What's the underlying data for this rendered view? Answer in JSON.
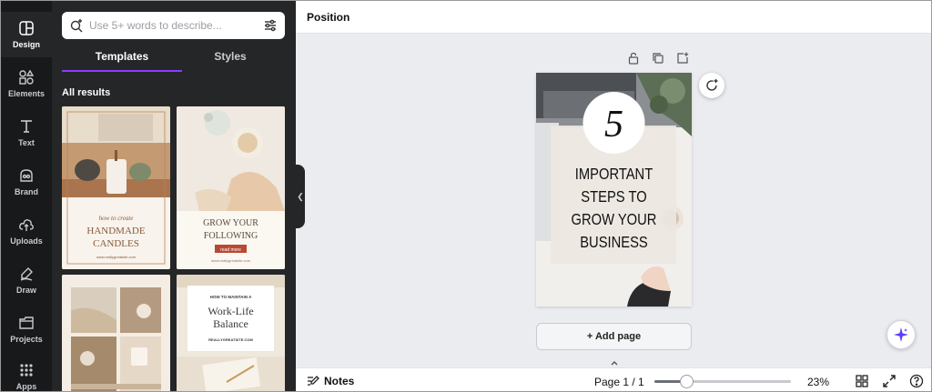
{
  "rail": {
    "items": [
      {
        "label": "Design",
        "icon": "design-icon"
      },
      {
        "label": "Elements",
        "icon": "elements-icon"
      },
      {
        "label": "Text",
        "icon": "text-icon"
      },
      {
        "label": "Brand",
        "icon": "brand-icon"
      },
      {
        "label": "Uploads",
        "icon": "uploads-icon"
      },
      {
        "label": "Draw",
        "icon": "draw-icon"
      },
      {
        "label": "Projects",
        "icon": "projects-icon"
      },
      {
        "label": "Apps",
        "icon": "apps-icon"
      }
    ],
    "active_index": 0
  },
  "panel": {
    "search_placeholder": "Use 5+ words to describe...",
    "tabs": [
      {
        "label": "Templates"
      },
      {
        "label": "Styles"
      }
    ],
    "results_heading": "All results",
    "templates": [
      {
        "line1": "how to create",
        "line2": "HANDMADE",
        "line3": "CANDLES",
        "footer": "www.reallygreatsite.com"
      },
      {
        "line1": "GROW YOUR",
        "line2": "FOLLOWING",
        "button": "read more",
        "footer": "www.reallygreatsite.com"
      },
      {
        "line1": "",
        "line2": ""
      },
      {
        "line1": "HOW TO MAINTAIN A",
        "line2": "Work-Life",
        "line3": "Balance",
        "footer": "REALLYGREATSITE.COM"
      }
    ]
  },
  "topbar": {
    "position_label": "Position"
  },
  "canvas": {
    "design": {
      "number": "5",
      "lines": [
        "IMPORTANT",
        "STEPS TO",
        "GROW YOUR",
        "BUSINESS"
      ]
    },
    "add_page_label": "+ Add page"
  },
  "bottombar": {
    "notes_label": "Notes",
    "page_indicator": "Page 1 / 1",
    "zoom_label": "23%",
    "zoom_fraction": 0.23
  },
  "colors": {
    "accent": "#8b3dff",
    "rail_bg": "#18191b",
    "panel_bg": "#252627",
    "canvas_bg": "#ebecf0"
  }
}
